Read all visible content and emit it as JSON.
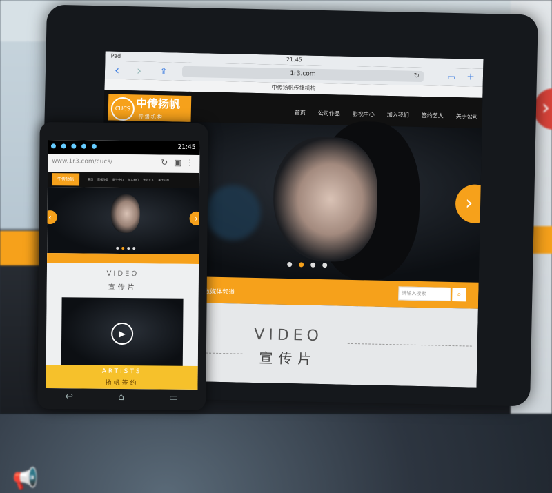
{
  "ipad": {
    "device_label": "iPad",
    "time": "21:45",
    "url": "1r3.com",
    "page_title": "中传扬帆传播机构",
    "logo": {
      "circle_text": "CUCS",
      "cn": "中传扬帆",
      "sub": "传播机构"
    },
    "menu": [
      "首页",
      "公司作品",
      "影视中心",
      "加入我们",
      "签约艺人",
      "关于公司"
    ],
    "band_label": "数媒体频道",
    "search_placeholder": "请输入搜索",
    "video_en": "VIDEO",
    "video_cn": "宣传片"
  },
  "phone": {
    "time": "21:45",
    "url": "www.1r3.com/cucs/",
    "logo": "中传扬帆",
    "menu": [
      "首页",
      "影视作品",
      "数字中心",
      "加入我们",
      "签约艺人",
      "关于公司"
    ],
    "video_en": "VIDEO",
    "video_cn": "宣传片",
    "artists_en": "ARTISTS",
    "artists_cn": "扬帆签约"
  },
  "colors": {
    "accent": "#f6a11b",
    "dark": "#111111"
  },
  "icons": [
    "back-icon",
    "forward-icon",
    "share-icon",
    "reload-icon",
    "search-icon",
    "play-icon",
    "megaphone-icon",
    "chevron-right-icon"
  ]
}
